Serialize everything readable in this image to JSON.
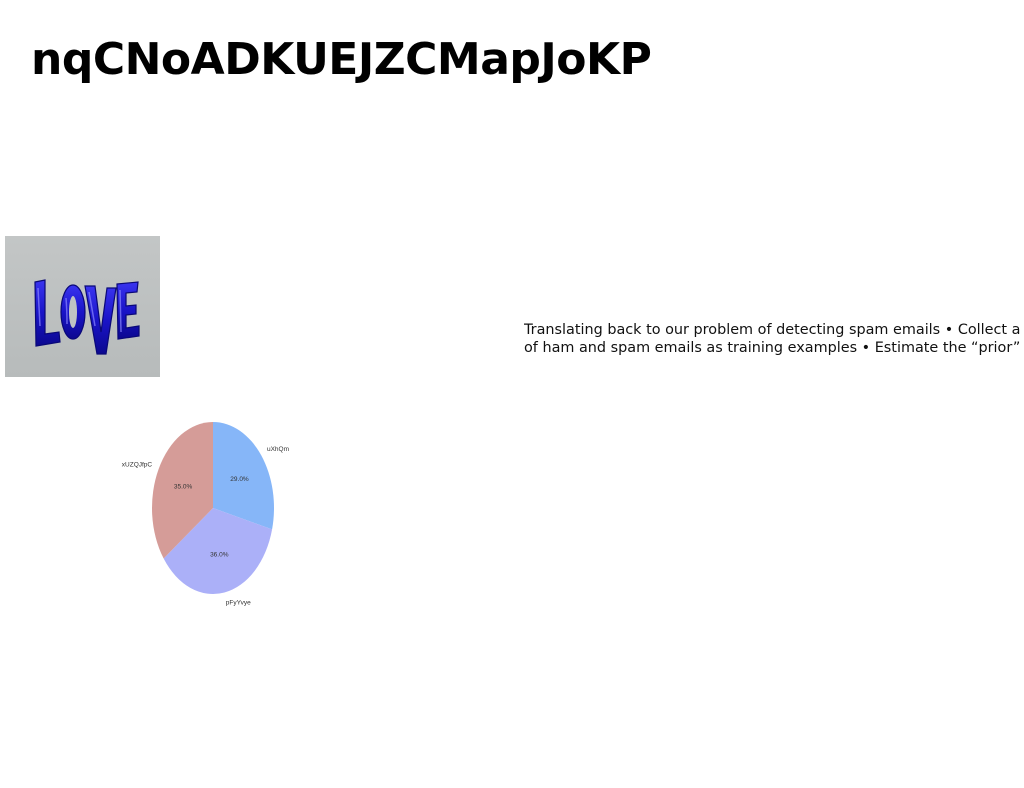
{
  "page": {
    "title": "nqCNoADKUEJZCMapJoKP",
    "body_lines": [
      "Translating back to our problem of detecting spam emails • Collect a",
      "of ham and spam emails as training examples • Estimate the “prior”"
    ]
  },
  "photo": {
    "icon": "love-balloon-letters-image",
    "lettering": "LOVE",
    "background_color": "#c0c4c4",
    "balloon_color": "#1a14c8"
  },
  "chart_data": {
    "type": "pie",
    "title": "",
    "slices": [
      {
        "label": "uXhQm",
        "value": 29.0,
        "pct_label": "29.0%",
        "color": "#86b6f8"
      },
      {
        "label": "pFyYvye",
        "value": 36.0,
        "pct_label": "36.0%",
        "color": "#abb0f8"
      },
      {
        "label": "xUZQJfpC",
        "value": 35.0,
        "pct_label": "35.0%",
        "color": "#d59c98"
      }
    ],
    "start_angle": "12 o'clock",
    "direction": "clockwise",
    "legend": "none"
  }
}
